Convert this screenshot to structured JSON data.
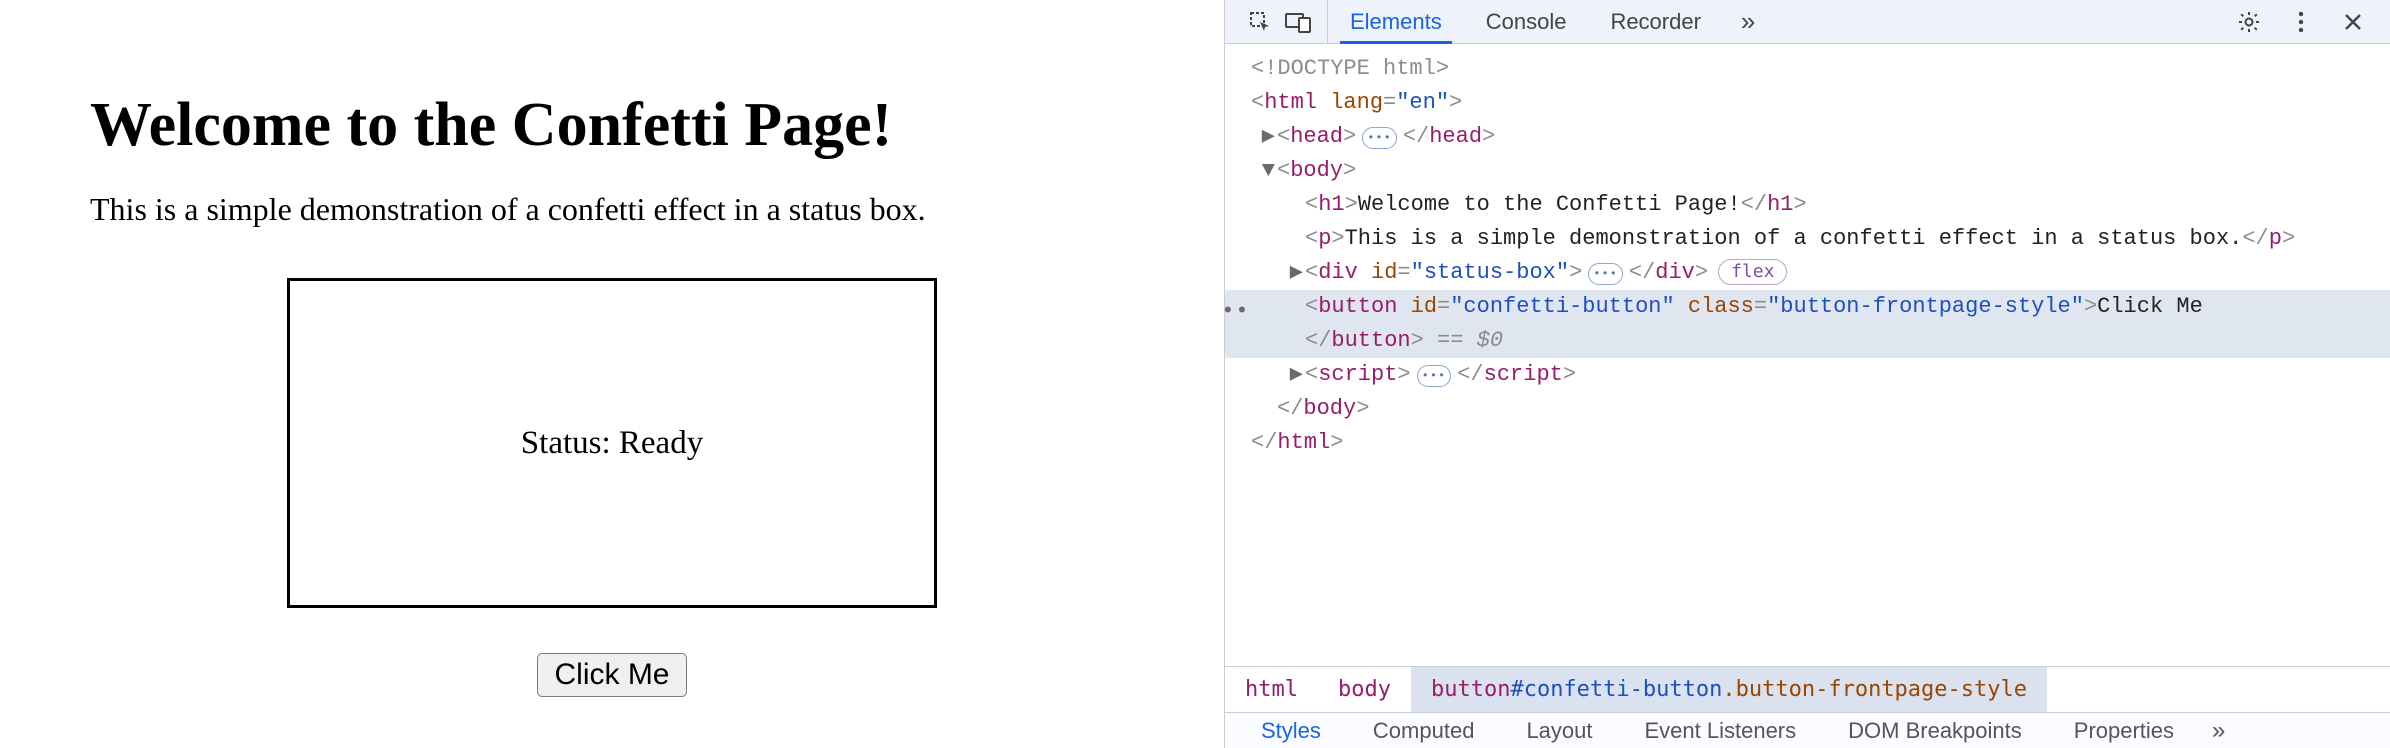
{
  "page": {
    "h1": "Welcome to the Confetti Page!",
    "p": "This is a simple demonstration of a confetti effect in a status box.",
    "status": "Status: Ready",
    "button": "Click Me"
  },
  "devtools": {
    "tabs": {
      "elements": "Elements",
      "console": "Console",
      "recorder": "Recorder",
      "more": "»"
    },
    "dom": {
      "doctype": "<!DOCTYPE html>",
      "html_open_tag": "html",
      "html_open_attr": "lang",
      "html_open_val": "\"en\"",
      "head_tag": "head",
      "body_tag": "body",
      "h1_tag": "h1",
      "h1_text": "Welcome to the Confetti Page!",
      "p_tag": "p",
      "p_text": "This is a simple demonstration of a confetti effect in a status box.",
      "div_tag": "div",
      "div_attr_id": "id",
      "div_val_id": "\"status-box\"",
      "flex_badge": "flex",
      "btn_tag": "button",
      "btn_attr_id": "id",
      "btn_val_id": "\"confetti-button\"",
      "btn_attr_class": "class",
      "btn_val_class": "\"button-frontpage-style\"",
      "btn_text": "Click Me",
      "eq0": " == $0",
      "script_tag": "script",
      "close_body": "body",
      "close_html": "html"
    },
    "breadcrumb": {
      "i0": "html",
      "i1": "body",
      "i2_tag": "button",
      "i2_id": "#confetti-button",
      "i2_class": ".button-frontpage-style"
    },
    "subtabs": {
      "styles": "Styles",
      "computed": "Computed",
      "layout": "Layout",
      "event": "Event Listeners",
      "dombp": "DOM Breakpoints",
      "props": "Properties",
      "more": "»"
    }
  }
}
